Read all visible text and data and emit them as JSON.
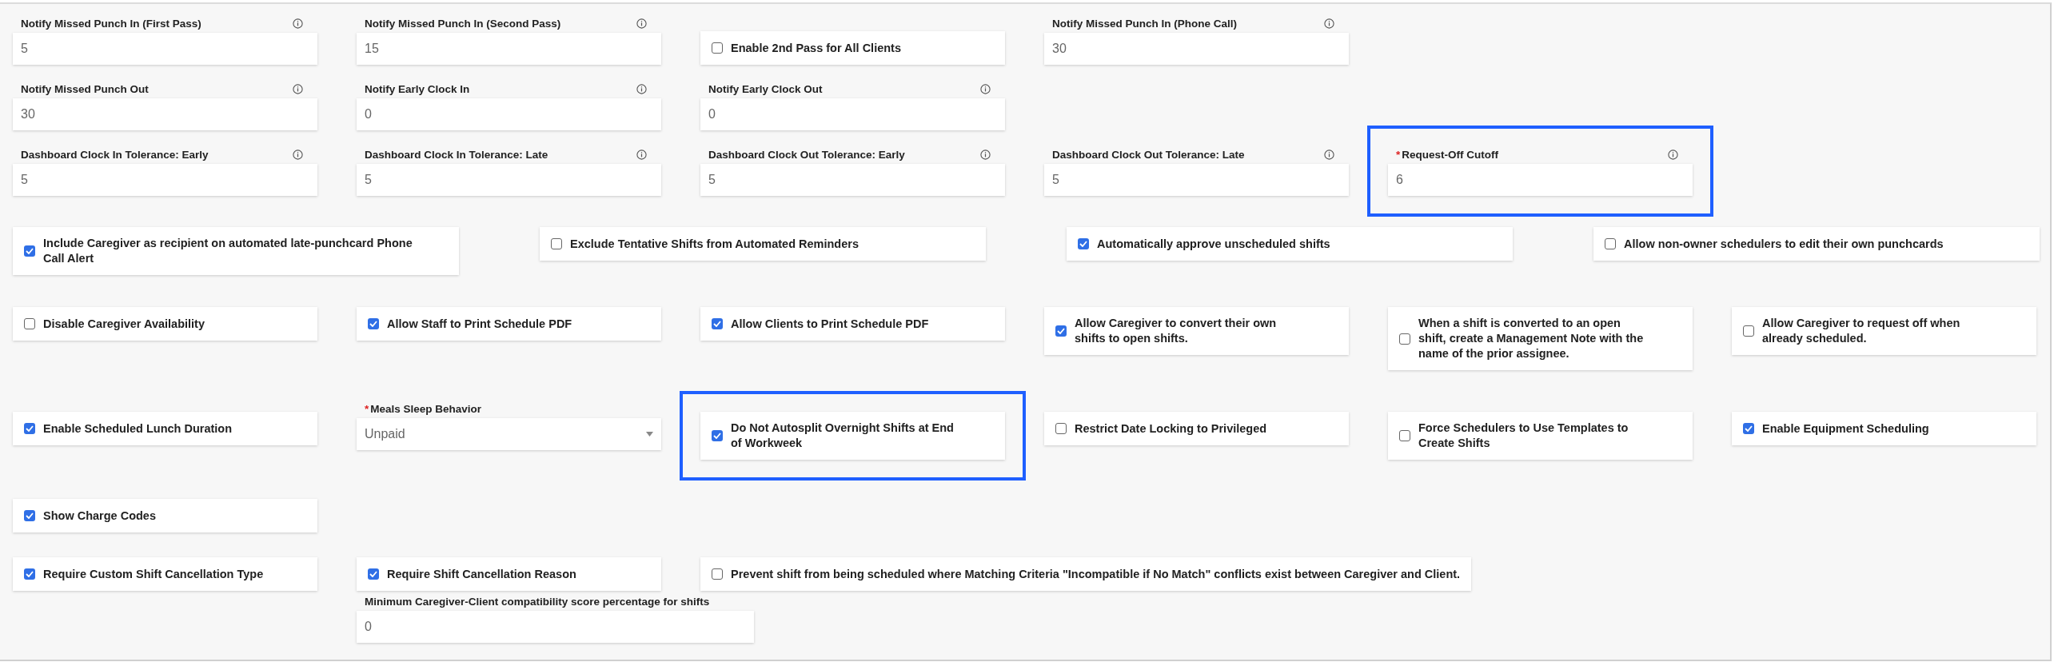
{
  "rows": [
    {
      "items": [
        {
          "kind": "number",
          "label": "Notify Missed Punch In (First Pass)",
          "value": "5",
          "info": true,
          "highlighted": false
        },
        {
          "kind": "number",
          "label": "Notify Missed Punch In (Second Pass)",
          "value": "15",
          "info": true,
          "highlighted": false
        },
        {
          "kind": "checkbox",
          "label": "Enable 2nd Pass for All Clients",
          "checked": false,
          "highlighted": false
        },
        {
          "kind": "number",
          "label": "Notify Missed Punch In (Phone Call)",
          "value": "30",
          "info": true,
          "highlighted": false
        }
      ]
    },
    {
      "items": [
        {
          "kind": "number",
          "label": "Notify Missed Punch Out",
          "value": "30",
          "info": true,
          "highlighted": false
        },
        {
          "kind": "number",
          "label": "Notify Early Clock In",
          "value": "0",
          "info": true,
          "highlighted": false
        },
        {
          "kind": "number",
          "label": "Notify Early Clock Out",
          "value": "0",
          "info": true,
          "highlighted": false
        }
      ]
    },
    {
      "items": [
        {
          "kind": "number",
          "label": "Dashboard Clock In Tolerance: Early",
          "value": "5",
          "info": true,
          "highlighted": false
        },
        {
          "kind": "number",
          "label": "Dashboard Clock In Tolerance: Late",
          "value": "5",
          "info": true,
          "highlighted": false
        },
        {
          "kind": "number",
          "label": "Dashboard Clock Out Tolerance: Early",
          "value": "5",
          "info": true,
          "highlighted": false
        },
        {
          "kind": "number",
          "label": "Dashboard Clock Out Tolerance: Late",
          "value": "5",
          "info": true,
          "highlighted": false
        },
        {
          "kind": "number",
          "label": "Request-Off Cutoff",
          "value": "6",
          "required_mark": "*",
          "info": true,
          "highlighted": true
        }
      ]
    },
    {
      "items": [
        {
          "kind": "checkbox",
          "label": "Include Caregiver as recipient on automated late-punchcard Phone Call Alert",
          "checked": true,
          "highlighted": false
        },
        {
          "kind": "checkbox",
          "label": "Exclude Tentative Shifts from Automated Reminders",
          "checked": false,
          "highlighted": false
        },
        {
          "kind": "checkbox",
          "label": "Automatically approve unscheduled shifts",
          "checked": true,
          "highlighted": false
        },
        {
          "kind": "checkbox",
          "label": "Allow non-owner schedulers to edit their own punchcards",
          "checked": false,
          "highlighted": false
        }
      ]
    },
    {
      "items": [
        {
          "kind": "checkbox",
          "label": "Disable Caregiver Availability",
          "checked": false,
          "highlighted": false
        },
        {
          "kind": "checkbox",
          "label": "Allow Staff to Print Schedule PDF",
          "checked": true,
          "highlighted": false
        },
        {
          "kind": "checkbox",
          "label": "Allow Clients to Print Schedule PDF",
          "checked": true,
          "highlighted": false
        },
        {
          "kind": "checkbox",
          "label": "Allow Caregiver to convert their own shifts to open shifts.",
          "checked": true,
          "highlighted": false
        },
        {
          "kind": "checkbox",
          "label": "When a shift is converted to an open shift, create a Management Note with the name of the prior assignee.",
          "checked": false,
          "highlighted": false
        },
        {
          "kind": "checkbox",
          "label": "Allow Caregiver to request off when already scheduled.",
          "checked": false,
          "highlighted": false
        }
      ]
    },
    {
      "items": [
        {
          "kind": "checkbox",
          "label": "Enable Scheduled Lunch Duration",
          "checked": true,
          "highlighted": false
        },
        {
          "kind": "select",
          "label": "Meals Sleep Behavior",
          "value": "Unpaid",
          "required_mark": "*",
          "info": false,
          "highlighted": false
        },
        {
          "kind": "checkbox",
          "label": "Do Not Autosplit Overnight Shifts at End of Workweek",
          "checked": true,
          "highlighted": true
        },
        {
          "kind": "checkbox",
          "label": "Restrict Date Locking to Privileged",
          "checked": false,
          "highlighted": false
        },
        {
          "kind": "checkbox",
          "label": "Force Schedulers to Use Templates to Create Shifts",
          "checked": false,
          "highlighted": false
        },
        {
          "kind": "checkbox",
          "label": "Enable Equipment Scheduling",
          "checked": true,
          "highlighted": false
        }
      ]
    },
    {
      "items": [
        {
          "kind": "checkbox",
          "label": "Show Charge Codes",
          "checked": true,
          "highlighted": false
        }
      ]
    },
    {
      "items": [
        {
          "kind": "checkbox",
          "label": "Require Custom Shift Cancellation Type",
          "checked": true,
          "highlighted": false
        },
        {
          "kind": "checkbox",
          "label": "Require Shift Cancellation Reason",
          "checked": true,
          "highlighted": false
        },
        {
          "kind": "checkbox",
          "label": "Prevent shift from being scheduled where Matching Criteria \"Incompatible if No Match\" conflicts exist between Caregiver and Client.",
          "checked": false,
          "highlighted": false
        }
      ]
    },
    {
      "items": [
        {
          "kind": "number",
          "label": "Minimum Caregiver-Client compatibility score percentage for shifts",
          "value": "0",
          "info": false,
          "highlighted": false
        }
      ]
    }
  ]
}
